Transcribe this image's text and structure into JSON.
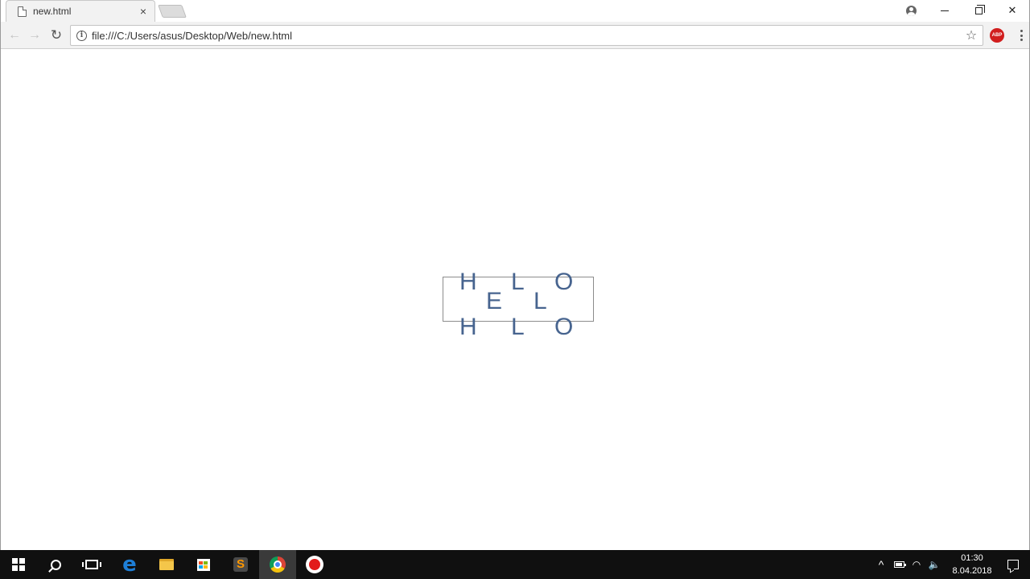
{
  "browser": {
    "tab": {
      "title": "new.html",
      "close_glyph": "×"
    },
    "window_controls": {
      "minimize": "",
      "maximize": "",
      "close": "✕"
    },
    "toolbar": {
      "back_glyph": "←",
      "forward_glyph": "→",
      "reload_glyph": "↻",
      "url": "file:///C:/Users/asus/Desktop/Web/new.html",
      "info_glyph": "i",
      "star_glyph": "☆",
      "abp_label": "ABP"
    }
  },
  "page": {
    "letters": [
      {
        "char": "H",
        "row": "top"
      },
      {
        "char": "L",
        "row": "top"
      },
      {
        "char": "O",
        "row": "top"
      },
      {
        "char": "E",
        "row": "middle"
      },
      {
        "char": "L",
        "row": "middle"
      },
      {
        "char": "H",
        "row": "bottom"
      },
      {
        "char": "L",
        "row": "bottom"
      },
      {
        "char": "O",
        "row": "bottom"
      }
    ],
    "letter_color": "#47648f"
  },
  "taskbar": {
    "apps": [
      "start-icon",
      "search-icon",
      "task-view-icon",
      "edge-icon",
      "file-explorer-icon",
      "store-icon",
      "sublime-text-icon",
      "chrome-icon",
      "recorder-icon"
    ],
    "tray": {
      "chevron": "^",
      "volume_glyph": "🔈",
      "wifi_glyph": "◠",
      "time": "01:30",
      "date": "8.04.2018"
    }
  }
}
